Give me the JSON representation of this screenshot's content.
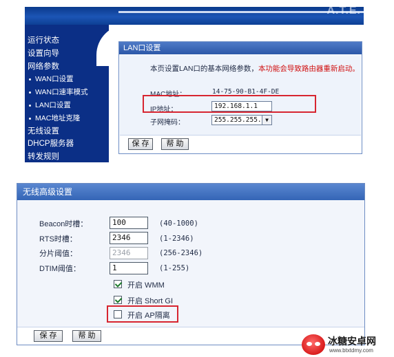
{
  "top": {
    "brand": "A.T.E.",
    "sidebar": {
      "items": [
        {
          "label": "运行状态",
          "sub": false
        },
        {
          "label": "设置向导",
          "sub": false
        },
        {
          "label": "网络参数",
          "sub": false
        },
        {
          "label": "WAN口设置",
          "sub": true
        },
        {
          "label": "WAN口速率模式",
          "sub": true
        },
        {
          "label": "LAN口设置",
          "sub": true
        },
        {
          "label": "MAC地址克隆",
          "sub": true
        },
        {
          "label": "无线设置",
          "sub": false
        },
        {
          "label": "DHCP服务器",
          "sub": false
        },
        {
          "label": "转发规则",
          "sub": false
        }
      ]
    },
    "panel": {
      "title": "LAN口设置",
      "notice": "本页设置LAN口的基本网络参数，",
      "warning": "本功能会导致路由器重新启动。",
      "mac_label": "MAC地址：",
      "mac_value": "14-75-90-B1-4F-DE",
      "ip_label": "IP地址：",
      "ip_value": "192.168.1.1",
      "mask_label": "子网掩码：",
      "mask_value": "255.255.255.0",
      "save_label": "保 存",
      "help_label": "帮 助"
    }
  },
  "bottom": {
    "title": "无线高级设置",
    "fields": [
      {
        "label": "Beacon时槽：",
        "value": "100",
        "range": "(40-1000)",
        "disabled": false
      },
      {
        "label": "RTS时槽：",
        "value": "2346",
        "range": "(1-2346)",
        "disabled": false
      },
      {
        "label": "分片阈值：",
        "value": "2346",
        "range": "(256-2346)",
        "disabled": true
      },
      {
        "label": "DTIM阈值：",
        "value": "1",
        "range": "(1-255)",
        "disabled": false
      }
    ],
    "options": [
      {
        "label": "开启 WMM",
        "checked": true
      },
      {
        "label": "开启 Short GI",
        "checked": true
      },
      {
        "label": "开启 AP隔离",
        "checked": false
      }
    ],
    "save_label": "保 存",
    "help_label": "帮 助"
  },
  "watermark": {
    "title": "冰糖安卓网",
    "url": "www.btxtdmy.com"
  },
  "colors": {
    "sidebar": "#0b2f86",
    "panel_header": "#2c58a8",
    "highlight": "#d7242f",
    "warning_text": "#d01010"
  }
}
